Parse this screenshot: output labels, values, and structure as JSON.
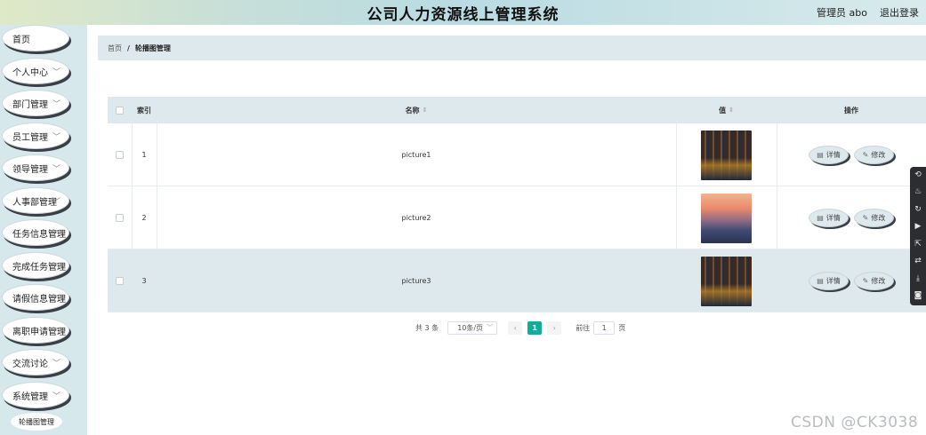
{
  "header": {
    "title": "公司人力资源线上管理系统",
    "user_label": "管理员 abo",
    "logout_label": "退出登录"
  },
  "sidebar": {
    "items": [
      {
        "label": "首页",
        "has_chevron": false
      },
      {
        "label": "个人中心",
        "has_chevron": true
      },
      {
        "label": "部门管理",
        "has_chevron": true
      },
      {
        "label": "员工管理",
        "has_chevron": true
      },
      {
        "label": "领导管理",
        "has_chevron": true
      },
      {
        "label": "人事部管理",
        "has_chevron": true
      },
      {
        "label": "任务信息管理",
        "has_chevron": true
      },
      {
        "label": "完成任务管理",
        "has_chevron": true
      },
      {
        "label": "请假信息管理",
        "has_chevron": true
      },
      {
        "label": "离职申请管理",
        "has_chevron": true
      },
      {
        "label": "交流讨论",
        "has_chevron": true
      },
      {
        "label": "系统管理",
        "has_chevron": true
      }
    ],
    "subitem": {
      "label": "轮播图管理"
    }
  },
  "breadcrumb": {
    "home": "首页",
    "separator": "/",
    "current": "轮播图管理"
  },
  "table": {
    "columns": {
      "index": "索引",
      "name": "名称",
      "value": "值",
      "actions": "操作"
    },
    "rows": [
      {
        "index": "1",
        "name": "picture1",
        "thumb": "night-city-canal"
      },
      {
        "index": "2",
        "name": "picture2",
        "thumb": "sunset-coast-town"
      },
      {
        "index": "3",
        "name": "picture3",
        "thumb": "night-city-canal"
      }
    ],
    "detail_label": "详情",
    "edit_label": "修改"
  },
  "pagination": {
    "total": "共 3 条",
    "page_size": "10条/页",
    "prev": "‹",
    "current_page": "1",
    "next": "›",
    "goto_label": "前往",
    "goto_value": "1",
    "page_suffix": "页"
  },
  "toolbar_icons": [
    "refresh-icon",
    "fire-icon",
    "share-icon",
    "video-icon",
    "export-icon",
    "swap-icon",
    "download-icon",
    "camera-icon"
  ],
  "watermark": "CSDN @CK3038",
  "colors": {
    "accent": "#1aa89b",
    "sidebar_bg": "#d6e8ec",
    "table_header_bg": "#dde9ec"
  }
}
